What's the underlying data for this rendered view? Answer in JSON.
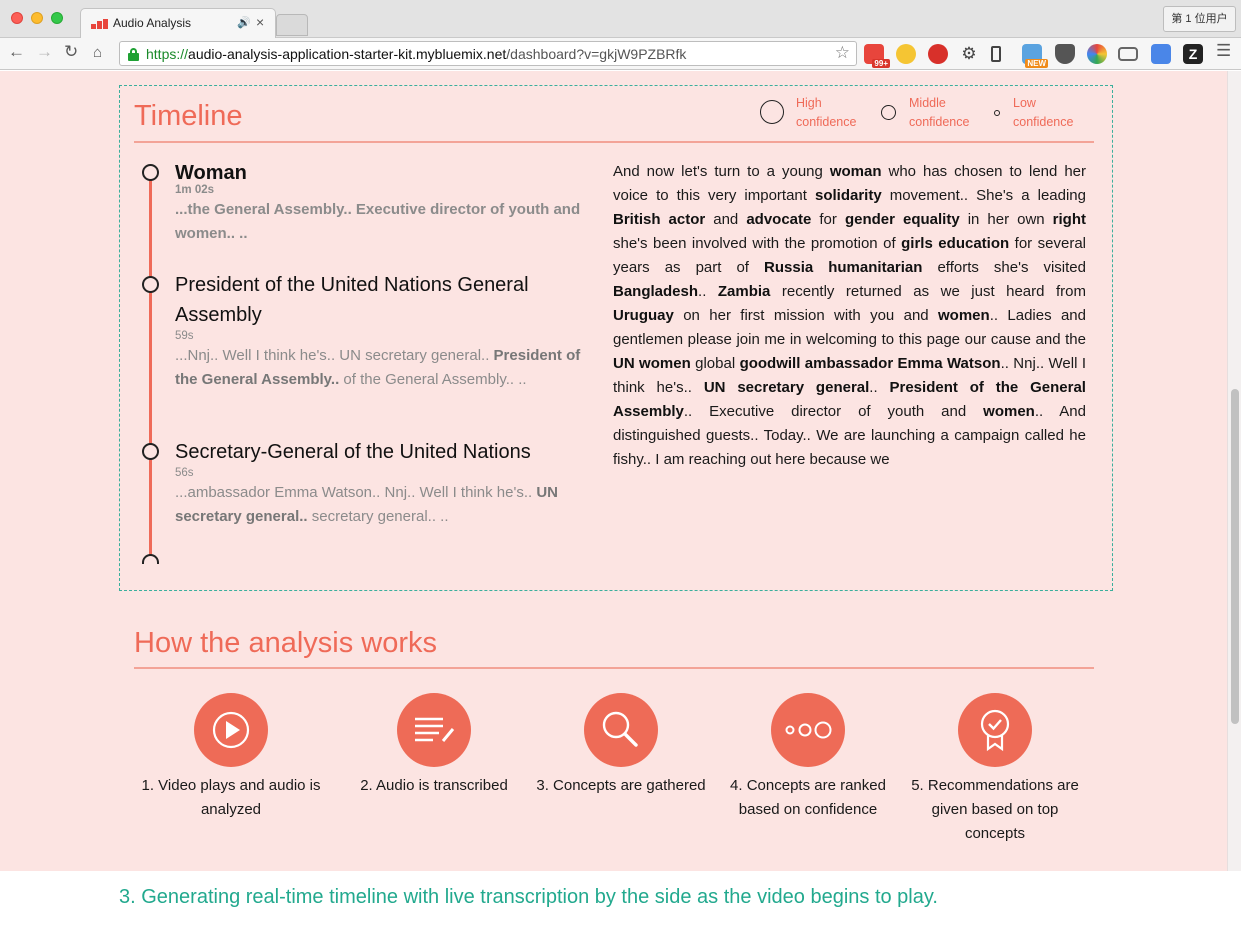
{
  "browser": {
    "tab_title": "Audio Analysis",
    "tab_audio_icon": "speaker-icon",
    "tab_close": "×",
    "user_button": "第 1 位用户",
    "url_protocol": "https://",
    "url_host": "audio-analysis-application-starter-kit.mybluemix.net",
    "url_path": "/dashboard?v=gkjW9PZBRfk",
    "extension_badges": {
      "ext1": "99+",
      "ext6": "NEW"
    }
  },
  "timeline": {
    "title": "Timeline",
    "legend": [
      {
        "line1": "High",
        "line2": "confidence"
      },
      {
        "line1": "Middle",
        "line2": "confidence"
      },
      {
        "line1": "Low",
        "line2": "confidence"
      }
    ],
    "entries": [
      {
        "title": "Woman",
        "time": "1m 02s",
        "snippet": "...the General Assembly.. Executive director of youth and women.. .."
      },
      {
        "title": "President of the United Nations General Assembly",
        "time": "59s",
        "snippet_pre": "...Nnj.. Well I think he's.. UN secretary general.. ",
        "snippet_bold": "President of the General Assembly..",
        "snippet_post": " of the General Assembly.. .."
      },
      {
        "title": "Secretary-General of the United Nations",
        "time": "56s",
        "snippet_pre": "...ambassador Emma Watson.. Nnj.. Well I think he's.. ",
        "snippet_bold": "UN secretary general..",
        "snippet_post": " secretary general.. .."
      }
    ],
    "transcript": [
      {
        "t": "And now let's turn to a young "
      },
      {
        "t": "woman",
        "b": true
      },
      {
        "t": " who has chosen to lend her voice to this very important "
      },
      {
        "t": "solidarity",
        "b": true
      },
      {
        "t": " movement.. She's a leading "
      },
      {
        "t": "British actor",
        "b": true
      },
      {
        "t": " and "
      },
      {
        "t": "advocate",
        "b": true
      },
      {
        "t": " for "
      },
      {
        "t": "gender equality",
        "b": true
      },
      {
        "t": " in her own "
      },
      {
        "t": "right",
        "b": true
      },
      {
        "t": " she's been involved with the promotion of "
      },
      {
        "t": "girls education",
        "b": true
      },
      {
        "t": " for several years as part of "
      },
      {
        "t": "Russia humanitarian",
        "b": true
      },
      {
        "t": " efforts she's visited "
      },
      {
        "t": "Bangladesh",
        "b": true
      },
      {
        "t": ".. "
      },
      {
        "t": "Zambia",
        "b": true
      },
      {
        "t": " recently returned as we just heard from "
      },
      {
        "t": "Uruguay",
        "b": true
      },
      {
        "t": " on her first mission with you and "
      },
      {
        "t": "women",
        "b": true
      },
      {
        "t": ".. Ladies and gentlemen please join me in welcoming to this page our cause and the "
      },
      {
        "t": "UN women",
        "b": true
      },
      {
        "t": " global "
      },
      {
        "t": "goodwill ambassador Emma Watson",
        "b": true
      },
      {
        "t": ".. Nnj.. Well I think he's.. "
      },
      {
        "t": "UN secretary general",
        "b": true
      },
      {
        "t": ".. "
      },
      {
        "t": "President of the General Assembly",
        "b": true
      },
      {
        "t": ".. Executive director of youth and "
      },
      {
        "t": "women",
        "b": true
      },
      {
        "t": ".. And distinguished guests.. Today.. We are launching a campaign called he fishy.. I am reaching out here because we"
      }
    ]
  },
  "how": {
    "title": "How the analysis works",
    "steps": [
      {
        "label": "1. Video plays and audio is analyzed",
        "icon": "play-icon"
      },
      {
        "label": "2. Audio is transcribed",
        "icon": "transcribe-icon"
      },
      {
        "label": "3. Concepts are gathered",
        "icon": "magnifier-icon"
      },
      {
        "label": "4. Concepts are ranked based on confidence",
        "icon": "ranked-circles-icon"
      },
      {
        "label": "5. Recommendations are given based on top concepts",
        "icon": "award-badge-icon"
      }
    ]
  },
  "caption": "3. Generating real-time timeline with live transcription by the side as the video begins to play.",
  "colors": {
    "accent": "#ef6a58",
    "page_bg": "#fce4e2",
    "dash_border": "#3aaf9c",
    "caption": "#22a98e"
  }
}
